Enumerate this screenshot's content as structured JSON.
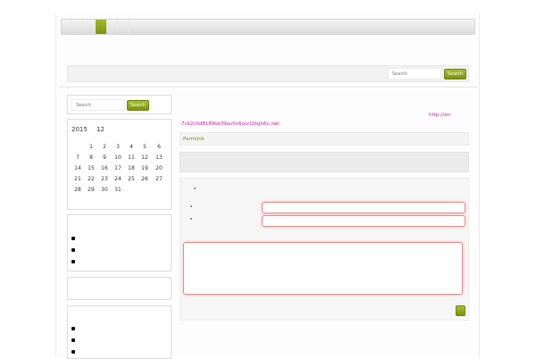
{
  "nav": {
    "tabs": [
      "",
      "",
      "",
      "",
      "",
      ""
    ],
    "active_index": 3
  },
  "header_search": {
    "placeholder": "Search",
    "button": "Search"
  },
  "sidebar_search": {
    "placeholder": "Search",
    "button": "Search"
  },
  "calendar": {
    "year": "2015",
    "month": "12",
    "weeks": [
      [
        "",
        "",
        "1",
        "2",
        "3",
        "4",
        "5",
        "6"
      ],
      [
        "7",
        "8",
        "9",
        "10",
        "11",
        "12",
        "13"
      ],
      [
        "14",
        "15",
        "16",
        "17",
        "18",
        "19",
        "20"
      ],
      [
        "21",
        "22",
        "23",
        "24",
        "25",
        "26",
        "27"
      ],
      [
        "28",
        "29",
        "30",
        "31",
        "",
        "",
        ""
      ]
    ]
  },
  "post": {
    "url_prefix": "http://xn-",
    "url_rest": "-7ck2c0d8189ke39av0v6ouri2bgh6c.net",
    "permalink": "Permlink"
  },
  "colors": {
    "accent": "#8ca51c",
    "link": "#c21ca8",
    "error_border": "#e88a86"
  }
}
